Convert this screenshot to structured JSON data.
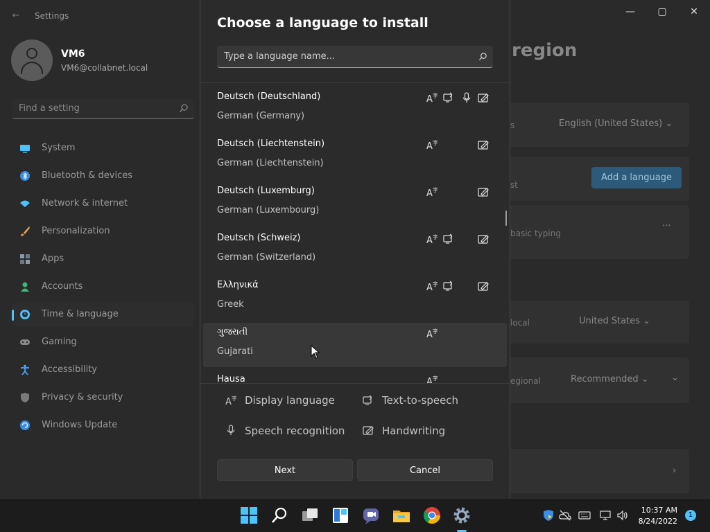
{
  "window": {
    "app_title": "Settings",
    "minimize": "—",
    "maximize": "▢",
    "close": "✕"
  },
  "user": {
    "name": "VM6",
    "email": "VM6@collabnet.local"
  },
  "search": {
    "placeholder": "Find a setting"
  },
  "sidebar": {
    "items": [
      {
        "label": "System",
        "icon": "monitor-icon",
        "color": "#4cc2ff"
      },
      {
        "label": "Bluetooth & devices",
        "icon": "bluetooth-icon",
        "color": "#3a8ee6"
      },
      {
        "label": "Network & internet",
        "icon": "wifi-icon",
        "color": "#4cc2ff"
      },
      {
        "label": "Personalization",
        "icon": "brush-icon",
        "color": "#e8a85a"
      },
      {
        "label": "Apps",
        "icon": "apps-icon",
        "color": "#8a9aa8"
      },
      {
        "label": "Accounts",
        "icon": "person-icon",
        "color": "#3fb87a"
      },
      {
        "label": "Time & language",
        "icon": "clock-globe-icon",
        "color": "#4cc2ff"
      },
      {
        "label": "Gaming",
        "icon": "gamepad-icon",
        "color": "#8a8a8a"
      },
      {
        "label": "Accessibility",
        "icon": "accessibility-icon",
        "color": "#4ca8ff"
      },
      {
        "label": "Privacy & security",
        "icon": "shield-icon",
        "color": "#7a7a7a"
      },
      {
        "label": "Windows Update",
        "icon": "update-icon",
        "color": "#3a8ee6"
      }
    ],
    "selected_index": 6
  },
  "background_page": {
    "title": "region",
    "rows": [
      {
        "text": "s",
        "value": "English (United States)"
      },
      {
        "text": "st",
        "button": "Add a language"
      },
      {
        "text": "basic typing",
        "more": "···"
      },
      {
        "text": "local",
        "value": "United States"
      },
      {
        "text": "egional",
        "value": "Recommended"
      }
    ]
  },
  "dialog": {
    "title": "Choose a language to install",
    "search_placeholder": "Type a language name...",
    "languages": [
      {
        "name": "Deutsch (Deutschland)",
        "english": "German (Germany)",
        "features": {
          "display": true,
          "tts": true,
          "speech": true,
          "handwriting": true
        }
      },
      {
        "name": "Deutsch (Liechtenstein)",
        "english": "German (Liechtenstein)",
        "features": {
          "display": true,
          "tts": false,
          "speech": false,
          "handwriting": true
        }
      },
      {
        "name": "Deutsch (Luxemburg)",
        "english": "German (Luxembourg)",
        "features": {
          "display": true,
          "tts": false,
          "speech": false,
          "handwriting": true
        }
      },
      {
        "name": "Deutsch (Schweiz)",
        "english": "German (Switzerland)",
        "features": {
          "display": true,
          "tts": true,
          "speech": false,
          "handwriting": true
        }
      },
      {
        "name": "Ελληνικά",
        "english": "Greek",
        "features": {
          "display": true,
          "tts": true,
          "speech": false,
          "handwriting": true
        }
      },
      {
        "name": "ગુજરાતી",
        "english": "Gujarati",
        "features": {
          "display": true,
          "tts": false,
          "speech": false,
          "handwriting": false
        }
      },
      {
        "name": "Hausa",
        "english": "",
        "features": {
          "display": true,
          "tts": false,
          "speech": false,
          "handwriting": false
        }
      }
    ],
    "hovered_index": 5,
    "legend": {
      "display": "Display language",
      "tts": "Text-to-speech",
      "speech": "Speech recognition",
      "handwriting": "Handwriting"
    },
    "next_label": "Next",
    "cancel_label": "Cancel"
  },
  "taskbar": {
    "apps": [
      "windows-start-icon",
      "search-icon",
      "task-view-icon",
      "widgets-icon",
      "teams-chat-icon",
      "file-explorer-icon",
      "chrome-icon",
      "settings-app-icon"
    ],
    "time": "10:37 AM",
    "date": "8/24/2022",
    "notification_count": "1"
  }
}
